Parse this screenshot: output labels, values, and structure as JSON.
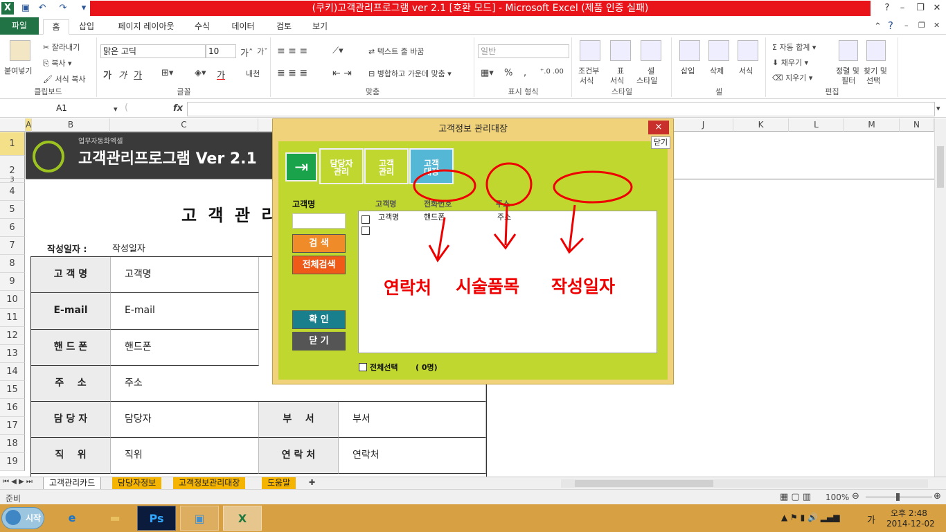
{
  "window": {
    "title": "(쿠키)고객관리프로그램 ver 2.1  [호환 모드] - Microsoft Excel (제품 인증 실패)"
  },
  "ribbon_tabs": [
    "파일",
    "홈",
    "삽입",
    "페이지 레이아웃",
    "수식",
    "데이터",
    "검토",
    "보기"
  ],
  "ribbon": {
    "clipboard": {
      "paste": "붙여넣기",
      "cut": "잘라내기",
      "copy": "복사",
      "format_painter": "서식 복사",
      "label": "클립보드"
    },
    "font": {
      "name": "맑은 고딕",
      "size": "10",
      "label": "글꼴",
      "bold": "가",
      "italic": "가",
      "underline": "가",
      "font_color": "가",
      "phonetic": "내천"
    },
    "align": {
      "wrap": "텍스트 줄 바꿈",
      "merge": "병합하고 가운데 맞춤",
      "label": "맞춤"
    },
    "number": {
      "format": "일반",
      "label": "표시 형식",
      "percent": "%",
      "comma": ","
    },
    "styles": {
      "cond": "조건부",
      "cond2": "서식",
      "table": "표",
      "table2": "서식",
      "cell": "셀",
      "cell2": "스타일",
      "label": "스타일"
    },
    "cells": {
      "insert": "삽입",
      "delete": "삭제",
      "format": "서식",
      "label": "셀"
    },
    "editing": {
      "autosum": "자동 합계",
      "fill": "채우기",
      "clear": "지우기",
      "sort": "정렬 및",
      "sort2": "필터",
      "find": "찾기 및",
      "find2": "선택",
      "label": "편집"
    }
  },
  "formula_bar": {
    "name_box": "A1",
    "fx": "fx",
    "formula": ""
  },
  "columns": [
    "A",
    "B",
    "C",
    "J",
    "K",
    "L",
    "M",
    "N"
  ],
  "rows": [
    "1",
    "2",
    "3",
    "4",
    "5",
    "6",
    "7",
    "8",
    "9",
    "10",
    "11",
    "12",
    "13",
    "14",
    "15",
    "16",
    "17",
    "18",
    "19"
  ],
  "banner": {
    "subtitle": "업무자동화엑셀",
    "title": "고객관리프로그램 Ver 2.1"
  },
  "form": {
    "heading": "고 객 관 리",
    "date_label": "작성일자 :",
    "date_value": "작성일자",
    "rows": [
      {
        "label": "고 객 명",
        "value": "고객명"
      },
      {
        "label": "E-mail",
        "value": "E-mail"
      },
      {
        "label": "핸 드 폰",
        "value": "핸드폰"
      },
      {
        "label": "주    소",
        "value": "주소"
      },
      {
        "label": "담 당 자",
        "value": "담당자",
        "label2": "부    서",
        "value2": "부서"
      },
      {
        "label": "직    위",
        "value": "직위",
        "label2": "연 락 처",
        "value2": "연락처"
      }
    ]
  },
  "dialog": {
    "title": "고객정보 관리대장",
    "close": "×",
    "close_tag": "닫기",
    "nav": [
      {
        "line1": "담당자",
        "line2": "관리"
      },
      {
        "line1": "고객",
        "line2": "관리"
      },
      {
        "line1": "고객",
        "line2": "대장"
      }
    ],
    "search_label": "고객명",
    "search_value": "",
    "btn_search": "검  색",
    "btn_search_all": "전체검색",
    "btn_ok": "확  인",
    "btn_close": "닫  기",
    "list_headers": [
      "고객명",
      "전화번호",
      "주소"
    ],
    "list_row": [
      "고객명",
      "핸드폰",
      "주소"
    ],
    "select_all": "전체선택",
    "count": "( 0명)",
    "annotations": [
      "연락처",
      "시술품목",
      "작성일자"
    ]
  },
  "sheet_tabs": [
    "고객관리카드",
    "담당자정보",
    "고객정보관리대장",
    "도움말"
  ],
  "status": {
    "ready": "준비",
    "zoom": "100%"
  },
  "taskbar": {
    "start": "시작",
    "ps": "Ps",
    "time": "오후 2:48",
    "date": "2014-12-02",
    "ime": "가"
  }
}
